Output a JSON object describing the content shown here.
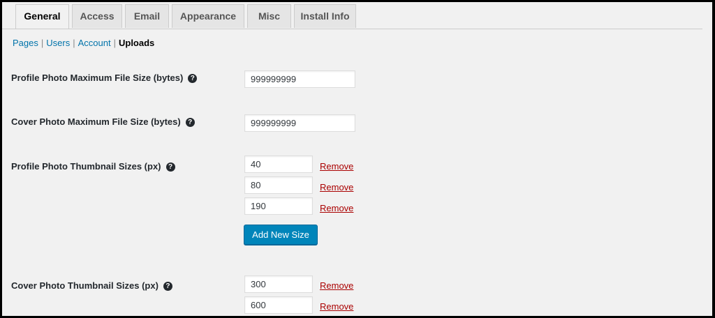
{
  "tabs": [
    {
      "label": "General",
      "active": true
    },
    {
      "label": "Access"
    },
    {
      "label": "Email"
    },
    {
      "label": "Appearance"
    },
    {
      "label": "Misc"
    },
    {
      "label": "Install Info"
    }
  ],
  "subnav": {
    "pages": "Pages",
    "users": "Users",
    "account": "Account",
    "uploads": "Uploads",
    "separator": "|"
  },
  "fields": {
    "profile_max": {
      "label": "Profile Photo Maximum File Size (bytes)",
      "value": "999999999"
    },
    "cover_max": {
      "label": "Cover Photo Maximum File Size (bytes)",
      "value": "999999999"
    },
    "profile_thumbs": {
      "label": "Profile Photo Thumbnail Sizes (px)",
      "values": [
        "40",
        "80",
        "190"
      ]
    },
    "cover_thumbs": {
      "label": "Cover Photo Thumbnail Sizes (px)",
      "values": [
        "300",
        "600"
      ]
    }
  },
  "help_glyph": "?",
  "help_icon": "question-circle-icon",
  "remove_label": "Remove",
  "add_size_label": "Add New Size",
  "colors": {
    "accent": "#0085ba",
    "link": "#0073aa",
    "remove": "#aa0000"
  }
}
